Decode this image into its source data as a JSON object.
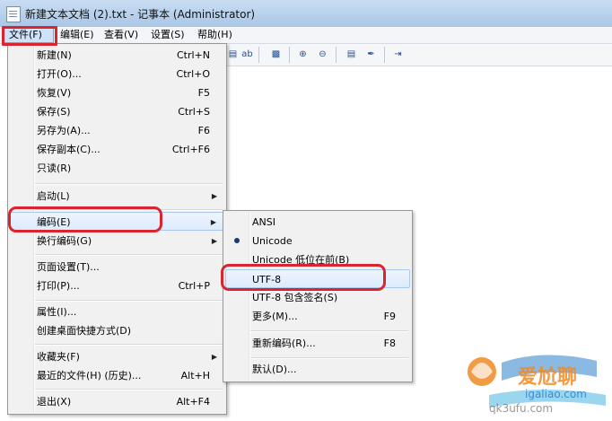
{
  "window": {
    "title": "新建文本文档 (2).txt - 记事本 (Administrator)"
  },
  "menubar": [
    {
      "label": "文件(F)"
    },
    {
      "label": "编辑(E)"
    },
    {
      "label": "查看(V)"
    },
    {
      "label": "设置(S)"
    },
    {
      "label": "帮助(H)"
    }
  ],
  "toolbar": {
    "icons": [
      "find-replace-icon",
      "spell-check-icon",
      "insert-icon",
      "zoom-in-icon",
      "zoom-out-icon",
      "view-icon",
      "pen-icon",
      "exit-icon"
    ]
  },
  "file_menu": {
    "items": [
      {
        "label": "新建(N)",
        "shortcut": "Ctrl+N"
      },
      {
        "label": "打开(O)...",
        "shortcut": "Ctrl+O"
      },
      {
        "label": "恢复(V)",
        "shortcut": "F5"
      },
      {
        "label": "保存(S)",
        "shortcut": "Ctrl+S"
      },
      {
        "label": "另存为(A)...",
        "shortcut": "F6"
      },
      {
        "label": "保存副本(C)...",
        "shortcut": "Ctrl+F6"
      },
      {
        "label": "只读(R)",
        "shortcut": ""
      },
      {
        "label": "启动(L)",
        "shortcut": ""
      },
      {
        "label": "编码(E)",
        "shortcut": ""
      },
      {
        "label": "换行编码(G)",
        "shortcut": ""
      },
      {
        "label": "页面设置(T)...",
        "shortcut": ""
      },
      {
        "label": "打印(P)...",
        "shortcut": "Ctrl+P"
      },
      {
        "label": "属性(I)...",
        "shortcut": ""
      },
      {
        "label": "创建桌面快捷方式(D)",
        "shortcut": ""
      },
      {
        "label": "收藏夹(F)",
        "shortcut": ""
      },
      {
        "label": "最近的文件(H) (历史)...",
        "shortcut": "Alt+H"
      },
      {
        "label": "退出(X)",
        "shortcut": "Alt+F4"
      }
    ]
  },
  "encoding_menu": {
    "items": [
      {
        "label": "ANSI",
        "shortcut": ""
      },
      {
        "label": "Unicode",
        "shortcut": ""
      },
      {
        "label": "Unicode 低位在前(B)",
        "shortcut": ""
      },
      {
        "label": "UTF-8",
        "shortcut": ""
      },
      {
        "label": "UTF-8 包含签名(S)",
        "shortcut": ""
      },
      {
        "label": "更多(M)...",
        "shortcut": "F9"
      },
      {
        "label": "重新编码(R)...",
        "shortcut": "F8"
      },
      {
        "label": "默认(D)...",
        "shortcut": ""
      }
    ],
    "selected": "Unicode"
  },
  "watermark": {
    "line1": "爱尬聊",
    "line2": "igaliao.com",
    "line3": "qk3ufu.com"
  },
  "colors": {
    "highlight_ring": "#d9252d",
    "menu_bg": "#f1f1f1",
    "titlebar": "#b9d2ee"
  }
}
